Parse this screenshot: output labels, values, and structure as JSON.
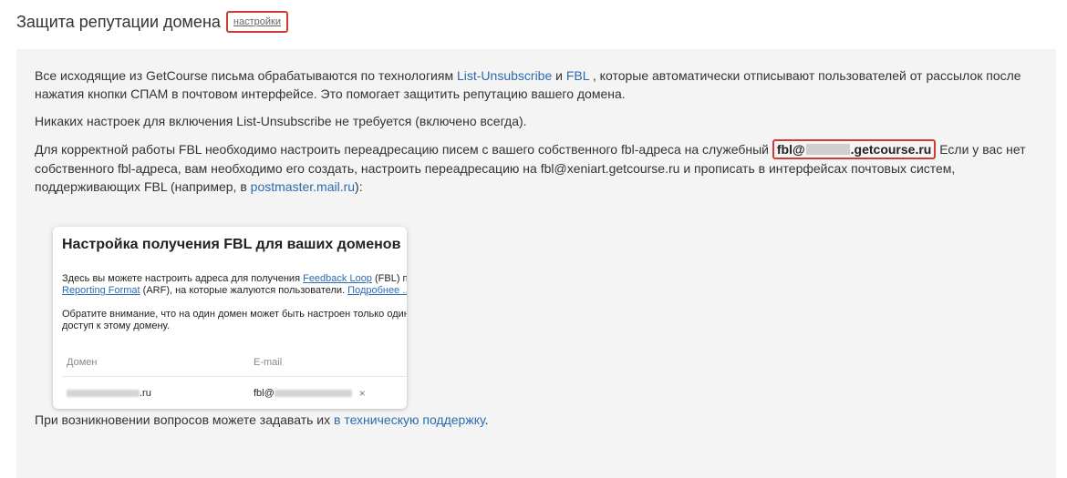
{
  "header": {
    "title": "Защита репутации домена",
    "settings_link": "настройки"
  },
  "intro": {
    "before": "Все исходящие из GetCourse письма обрабатываются по технологиям ",
    "link_unsub": "List-Unsubscribe",
    "and": " и ",
    "link_fbl": "FBL",
    "after": " , которые автоматически отписывают пользователей от рассылок после нажатия кнопки СПАМ в почтовом интерфейсе. Это помогает защитить репутацию вашего домена."
  },
  "no_settings": "Никаких настроек для включения List-Unsubscribe не требуется (включено всегда).",
  "fbl_para": {
    "before": "Для корректной работы FBL необходимо настроить переадресацию писем с вашего собственного fbl-адреса на служебный ",
    "address_prefix": "fbl@",
    "address_suffix": ".getcourse.ru",
    "after": " Если у вас нет собственного fbl-адреса, вам необходимо его создать, настроить переадресацию на fbl@xeniart.getcourse.ru и прописать в интерфейсах почтовых систем, поддерживающих FBL (например, в ",
    "link_postmaster": "postmaster.mail.ru",
    "end": "):"
  },
  "card": {
    "title": "Настройка получения FBL для ваших доменов",
    "line1_before": "Здесь вы можете настроить адреса для получения ",
    "line1_link": "Feedback Loop",
    "line1_after": " (FBL) по",
    "line2_link": "Reporting Format",
    "line2_after": " (ARF), на которые жалуются пользователи. ",
    "line2_more": "Подробнее ...",
    "line3": "Обратите внимание, что на один домен может быть настроен только один а",
    "line4": "доступ к этому домену.",
    "col_domain": "Домен",
    "col_email": "E-mail",
    "row_domain_suffix": ".ru",
    "row_email_prefix": "fbl@",
    "row_remove": "×"
  },
  "support": {
    "before": "При возникновении вопросов можете задавать их ",
    "link": "в техническую поддержку",
    "end": "."
  }
}
